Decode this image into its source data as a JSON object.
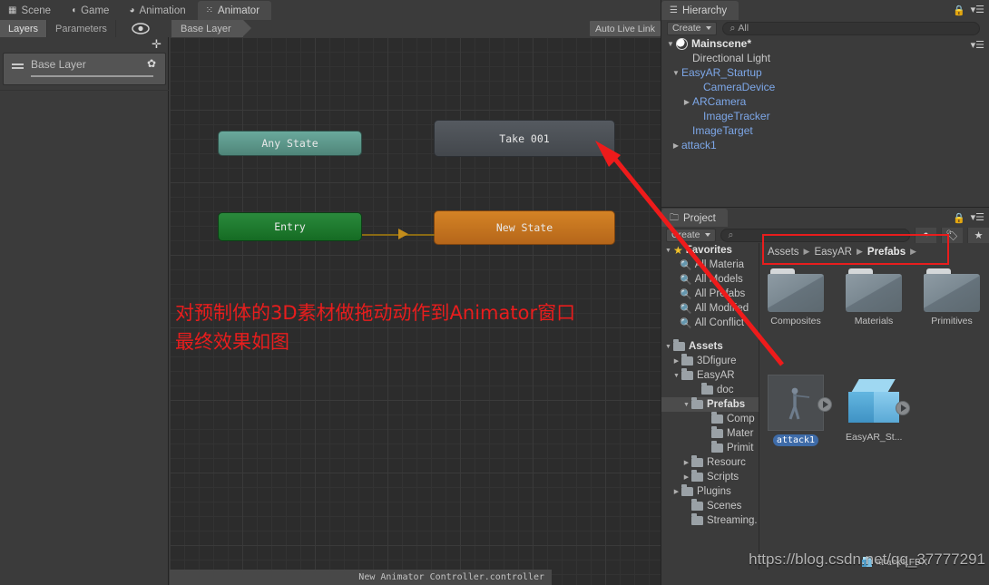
{
  "main_tabs": [
    {
      "label": "Scene",
      "icon": "grid-icon",
      "active": false
    },
    {
      "label": "Game",
      "icon": "gamepad-icon",
      "active": false
    },
    {
      "label": "Animation",
      "icon": "clock-icon",
      "active": false
    },
    {
      "label": "Animator",
      "icon": "animator-icon",
      "active": true
    }
  ],
  "animator": {
    "sub_tabs": [
      {
        "label": "Layers",
        "active": true
      },
      {
        "label": "Parameters",
        "active": false
      }
    ],
    "eye_icon": "eye-icon",
    "plus_icon": "plus-icon",
    "layer_card": {
      "name": "Base Layer",
      "gear_icon": "gear-icon",
      "burger_icon": "drag-handle-icon"
    },
    "breadcrumb": "Base Layer",
    "auto_live_link": "Auto Live Link",
    "nodes": [
      {
        "id": "any-state",
        "label": "Any State",
        "color": "#5b9488"
      },
      {
        "id": "entry",
        "label": "Entry",
        "color": "#1f7a2e"
      },
      {
        "id": "take-001",
        "label": "Take 001",
        "color": "#4b4f54"
      },
      {
        "id": "new-state",
        "label": "New State",
        "color": "#c5731f"
      }
    ],
    "overlay_note": "对预制体的3D素材做拖动动作到Animator窗口\n最终效果如图",
    "overlay_note_color": "#e81d1d",
    "status": "New Animator Controller.controller"
  },
  "hierarchy": {
    "tab_label": "Hierarchy",
    "tab_icon": "hierarchy-icon",
    "lock_icon": "lock-icon",
    "menu_icon": "panel-menu-icon",
    "create_label": "Create",
    "search_placeholder": "All",
    "search_icon": "search-icon",
    "scene": {
      "label": "Mainscene*",
      "icon": "unity-scene-icon",
      "expanded": true
    },
    "items": [
      {
        "label": "Directional Light",
        "indent": 1,
        "twisty": "",
        "prefab": false
      },
      {
        "label": "EasyAR_Startup",
        "indent": 1,
        "twisty": "▼",
        "prefab": true
      },
      {
        "label": "CameraDevice",
        "indent": 2,
        "twisty": "",
        "prefab": true
      },
      {
        "label": "ARCamera",
        "indent": 2,
        "twisty": "▶",
        "prefab": true
      },
      {
        "label": "ImageTracker",
        "indent": 2,
        "twisty": "",
        "prefab": true
      },
      {
        "label": "ImageTarget",
        "indent": 1,
        "twisty": "",
        "prefab": true
      },
      {
        "label": "attack1",
        "indent": 1,
        "twisty": "▶",
        "prefab": true
      }
    ]
  },
  "project": {
    "tab_label": "Project",
    "tab_icon": "folder-icon",
    "lock_icon": "lock-icon",
    "menu_icon": "panel-menu-icon",
    "create_label": "Create",
    "search_placeholder": "",
    "search_icon": "search-icon",
    "tool_buttons": [
      {
        "name": "filter-by-type-icon",
        "glyph": "◓"
      },
      {
        "name": "filter-by-label-icon",
        "glyph": "🏷"
      },
      {
        "name": "favorite-star-icon",
        "glyph": "★"
      }
    ],
    "favorites": {
      "label": "Favorites",
      "items": [
        "All Materia",
        "All Models",
        "All Prefabs",
        "All Modified",
        "All Conflict"
      ]
    },
    "assets_tree": [
      {
        "label": "Assets",
        "indent": 0,
        "twisty": "▼",
        "bold": true,
        "selected": false
      },
      {
        "label": "3Dfigure",
        "indent": 1,
        "twisty": "▶",
        "bold": false,
        "selected": false
      },
      {
        "label": "EasyAR",
        "indent": 1,
        "twisty": "▼",
        "bold": false,
        "selected": false
      },
      {
        "label": "doc",
        "indent": 2,
        "twisty": "",
        "bold": false,
        "selected": false
      },
      {
        "label": "Prefabs",
        "indent": 2,
        "twisty": "▼",
        "bold": true,
        "selected": true
      },
      {
        "label": "Comp",
        "indent": 3,
        "twisty": "",
        "bold": false,
        "selected": false
      },
      {
        "label": "Mater",
        "indent": 3,
        "twisty": "",
        "bold": false,
        "selected": false
      },
      {
        "label": "Primit",
        "indent": 3,
        "twisty": "",
        "bold": false,
        "selected": false
      },
      {
        "label": "Resourc",
        "indent": 2,
        "twisty": "▶",
        "bold": false,
        "selected": false
      },
      {
        "label": "Scripts",
        "indent": 2,
        "twisty": "▶",
        "bold": false,
        "selected": false
      },
      {
        "label": "Plugins",
        "indent": 1,
        "twisty": "▶",
        "bold": false,
        "selected": false
      },
      {
        "label": "Scenes",
        "indent": 1,
        "twisty": "",
        "bold": false,
        "selected": false
      },
      {
        "label": "Streaming.",
        "indent": 1,
        "twisty": "",
        "bold": false,
        "selected": false
      }
    ],
    "breadcrumb": [
      "Assets",
      "EasyAR",
      "Prefabs"
    ],
    "breadcrumb_highlight_color": "#e81d1d",
    "folders": [
      {
        "label": "Composites"
      },
      {
        "label": "Materials"
      },
      {
        "label": "Primitives"
      }
    ],
    "assets": [
      {
        "label": "attack1",
        "type": "model-thumbnail",
        "selected": true,
        "has_play": true
      },
      {
        "label": "EasyAR_St...",
        "type": "prefab-cube",
        "selected": false,
        "has_play": true
      }
    ],
    "status_file": "attack1.FBX",
    "status_icon": "prefab-cube-icon"
  },
  "watermark": "https://blog.csdn.net/qq_37777291"
}
